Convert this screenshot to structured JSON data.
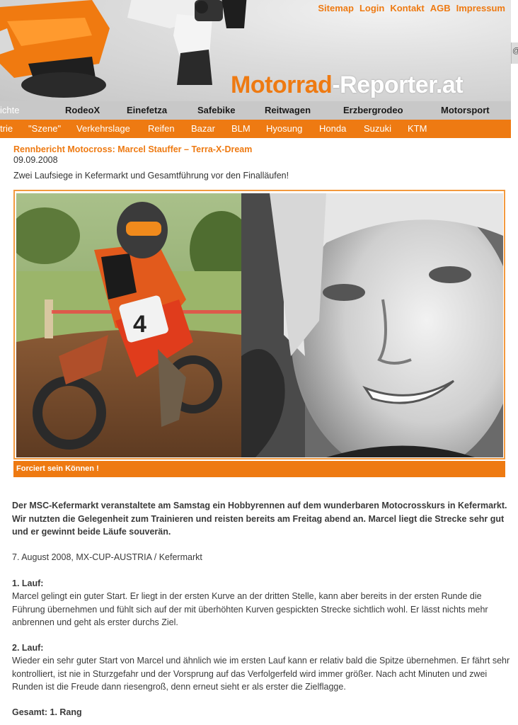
{
  "header": {
    "top_links": [
      "Sitemap",
      "Login",
      "Kontakt",
      "AGB",
      "Impressum"
    ],
    "logo_part1": "Motorrad",
    "logo_part2": "-Reporter.at",
    "edge_glyph": "@"
  },
  "nav_primary": {
    "items": [
      "ichte",
      "RodeoX",
      "Einefetza",
      "Safebike",
      "Reitwagen",
      "Erzbergrodeo",
      "Motorsport"
    ],
    "active_index": 0
  },
  "nav_secondary": {
    "items": [
      "trie",
      "\"Szene\"",
      "Verkehrslage",
      "Reifen",
      "Bazar",
      "BLM",
      "Hyosung",
      "Honda",
      "Suzuki",
      "KTM"
    ]
  },
  "article": {
    "title": "Rennbericht Motocross: Marcel Stauffer – Terra-X-Dream",
    "date": "09.09.2008",
    "lead": "Zwei Laufsiege in Kefermarkt und Gesamtführung vor den Finalläufen!",
    "photo_left_number": "4",
    "caption": "Forciert sein Können !",
    "intro": "Der MSC-Kefermarkt veranstaltete am Samstag ein Hobbyrennen auf dem wunderbaren Motocrosskurs in Kefermarkt. Wir nutzten die Gelegenheit zum Trainieren und reisten bereits am Freitag abend an. Marcel liegt die Strecke sehr gut und er gewinnt beide Läufe souverän.",
    "meta": "7. August 2008, MX-CUP-AUSTRIA / Kefermarkt",
    "lauf1_heading": "1. Lauf:",
    "lauf1_text": "Marcel gelingt ein guter Start. Er liegt in der ersten Kurve an der dritten Stelle, kann aber bereits in der ersten Runde die Führung übernehmen und fühlt sich auf der mit überhöhten Kurven gespickten Strecke sichtlich wohl. Er lässt nichts mehr anbrennen und geht als erster durchs Ziel.",
    "lauf2_heading": "2. Lauf:",
    "lauf2_text": "Wieder ein sehr guter Start von Marcel und ähnlich wie im ersten Lauf kann er relativ bald die Spitze übernehmen. Er fährt sehr kontrolliert, ist nie in Sturzgefahr und der Vorsprung auf das Verfolgerfeld wird immer größer. Nach acht Minuten und zwei Runden ist die Freude dann riesengroß, denn erneut sieht er als erster die Zielflagge.",
    "gesamt": "Gesamt: 1. Rang"
  },
  "colors": {
    "accent_orange": "#ee7a12",
    "nav_gray": "#c8c8c8",
    "frame_orange": "#f39a3f"
  }
}
